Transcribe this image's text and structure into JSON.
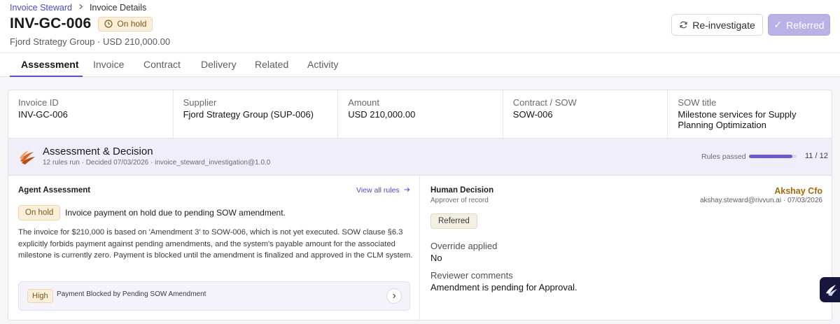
{
  "breadcrumb": {
    "root": "Invoice Steward",
    "current": "Invoice Details"
  },
  "header": {
    "title": "INV-GC-006",
    "status": "On hold",
    "subtitle": "Fjord Strategy Group · USD 210,000.00",
    "reinvestigate_label": "Re-investigate",
    "referred_label": "Referred",
    "referred_check": "✓"
  },
  "tabs": [
    "Assessment",
    "Invoice",
    "Contract",
    "Delivery",
    "Related",
    "Activity"
  ],
  "summary": [
    {
      "label": "Invoice ID",
      "value": "INV-GC-006"
    },
    {
      "label": "Supplier",
      "value": "Fjord Strategy Group (SUP-006)"
    },
    {
      "label": "Amount",
      "value": "USD 210,000.00"
    },
    {
      "label": "Contract / SOW",
      "value": "SOW-006"
    },
    {
      "label": "SOW title",
      "value": "Milestone services for Supply Planning Optimization"
    }
  ],
  "assessment": {
    "title": "Assessment & Decision",
    "meta": "12 rules run · Decided 07/03/2026 · invoice_steward_investigation@1.0.0",
    "rules_label": "Rules passed",
    "rules_passed": 11,
    "rules_total": 12,
    "rules_count": "11 / 12"
  },
  "agent": {
    "title": "Agent Assessment",
    "view_all": "View all rules",
    "status_pill": "On hold",
    "summary": "Invoice payment on hold due to pending SOW amendment.",
    "body": "The invoice for $210,000 is based on 'Amendment 3' to SOW-006, which is not yet executed. SOW clause §6.3 explicitly forbids payment against pending amendments, and the system's payable amount for the associated milestone is currently zero. Payment is blocked until the amendment is finalized and approved in the CLM system.",
    "rule": {
      "severity": "High",
      "text": "Payment Blocked by Pending SOW Amendment"
    }
  },
  "human": {
    "title": "Human Decision",
    "subtitle": "Approver of record",
    "approver": "Akshay Cfo",
    "approver_meta": "akshay.steward@rivvun.ai · 07/03/2026",
    "decision": "Referred",
    "override_label": "Override applied",
    "override_value": "No",
    "comments_label": "Reviewer comments",
    "comments_value": "Amendment is pending for Approval."
  },
  "colors": {
    "accent": "#5b4fc8",
    "hold_bg": "#fbefd9",
    "approver": "#a46a0c"
  },
  "icons": [
    "chevron-right-icon",
    "clock-icon",
    "refresh-icon",
    "check-icon",
    "assessment-logo-icon",
    "arrow-right-icon",
    "chevron-icon",
    "chat-widget-icon"
  ]
}
